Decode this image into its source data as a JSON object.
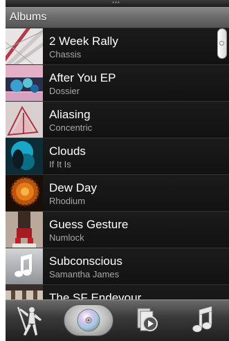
{
  "header": {
    "title": "Albums"
  },
  "albums": [
    {
      "title": "2 Week Rally",
      "artist": "Chassis"
    },
    {
      "title": "After You EP",
      "artist": "Dossier"
    },
    {
      "title": "Aliasing",
      "artist": "Concentric"
    },
    {
      "title": "Clouds",
      "artist": "If It Is"
    },
    {
      "title": "Dew Day",
      "artist": "Rhodium"
    },
    {
      "title": "Guess Gesture",
      "artist": "Numlock"
    },
    {
      "title": "Subconscious",
      "artist": "Samantha James"
    },
    {
      "title": "The SF Endevour",
      "artist": ""
    }
  ],
  "tabs": [
    {
      "icon": "artist-icon",
      "selected": false
    },
    {
      "icon": "album-disc-icon",
      "selected": true
    },
    {
      "icon": "playlist-icon",
      "selected": false
    },
    {
      "icon": "music-note-icon",
      "selected": false
    }
  ],
  "colors": {
    "background": "#141414",
    "header": "#6d6d6d",
    "title": "#ffffff",
    "subtitle": "#a8a8a8"
  }
}
